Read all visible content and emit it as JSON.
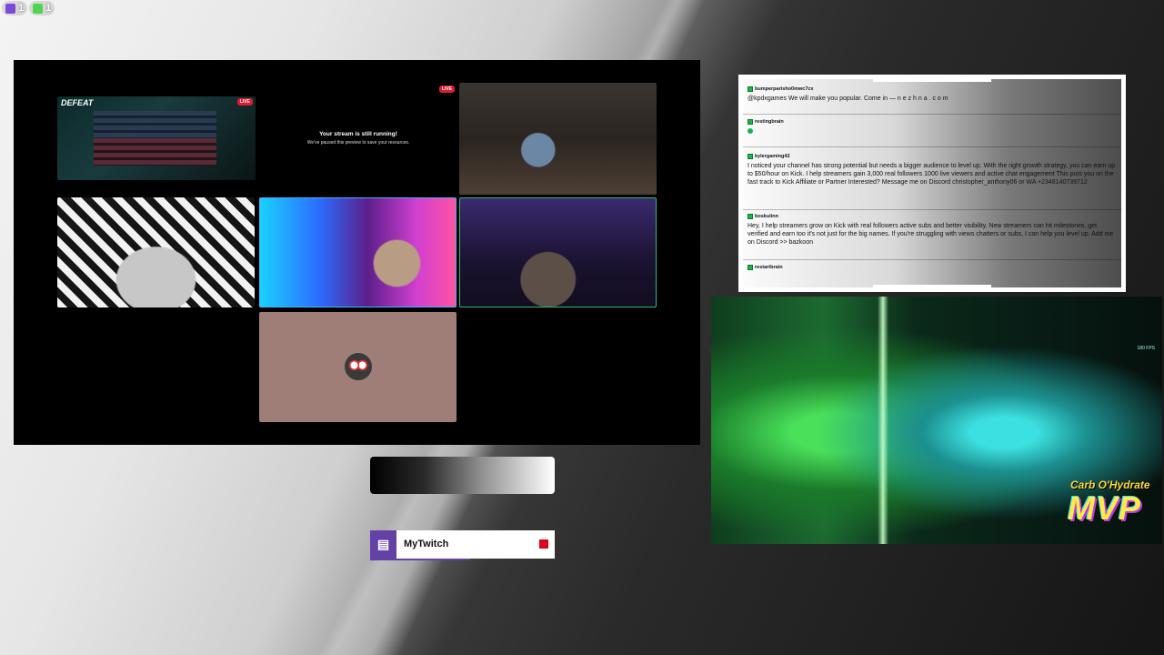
{
  "topbar": {
    "twitch_count": "1",
    "kick_count": "1"
  },
  "call": {
    "game_tile": {
      "banner": "DEFEAT",
      "live_label": "LIVE"
    },
    "paused_tile": {
      "live_label": "LIVE",
      "title": "Your stream is still running!",
      "subtitle": "We've paused this preview to save your resources."
    }
  },
  "source_bar": {
    "icon": "twitch-icon",
    "name": "MyTwitch",
    "status_color": "#e0001a"
  },
  "chat": {
    "messages": [
      {
        "user": "bumperparisho0mwc7cx",
        "text": "@kpdxgames We will make you popular. Come in — n e z h n a . c o m"
      },
      {
        "user": "restingbrain",
        "text": ""
      },
      {
        "user": "kylergaming42",
        "text": "I noticed your channel has strong potential but needs a bigger audience to level up. With the right growth strategy, you can earn up to $50/hour on Kick. I help streamers gain 3,000 real followers 1000 live viewers and active chat engagement This puts you on the fast track to Kick Affiliate or Partner Interested? Message me on Discord christopher_anthony06 or WA +2348140739712"
      },
      {
        "user": "boskuiinn",
        "text": "Hey, I help streamers grow on Kick with real followers active subs and better visibility. New streamers can hit milestones, get verified and earn too it's not just for the big names. If you're struggling with views chatters or subs, I can help you level up. Add me on Discord >> bazkoon"
      },
      {
        "user": "restartbrain",
        "text": ""
      }
    ]
  },
  "game": {
    "mvp_player": "Carb O'Hydrate",
    "mvp_label": "MVP",
    "fps": "180 FPS"
  },
  "colors": {
    "twitch": "#6441a5",
    "kick": "#53fc18",
    "live": "#e21b2f"
  }
}
